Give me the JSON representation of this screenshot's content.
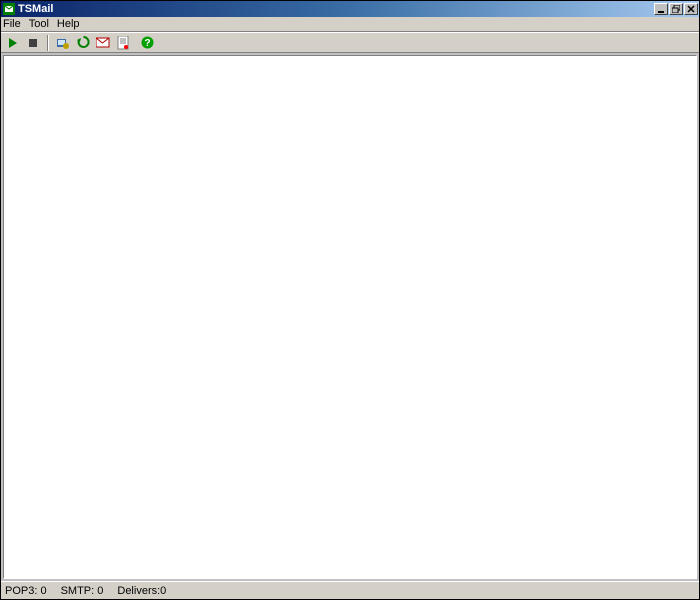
{
  "titlebar": {
    "app_name": "TSMail",
    "app_icon": "mail-app-icon"
  },
  "window_controls": {
    "minimize": "_",
    "maximize": "❐",
    "close": "✕"
  },
  "menu": {
    "items": [
      "File",
      "Tool",
      "Help"
    ]
  },
  "toolbar": {
    "play_icon": "play-icon",
    "stop_icon": "stop-icon",
    "config_icon": "settings-icon",
    "refresh_icon": "refresh-icon",
    "mail_icon": "mail-icon",
    "log_icon": "log-icon",
    "help_icon": "help-icon"
  },
  "status": {
    "pop3": "POP3: 0",
    "smtp": "SMTP: 0",
    "delivers": "Delivers:0"
  }
}
